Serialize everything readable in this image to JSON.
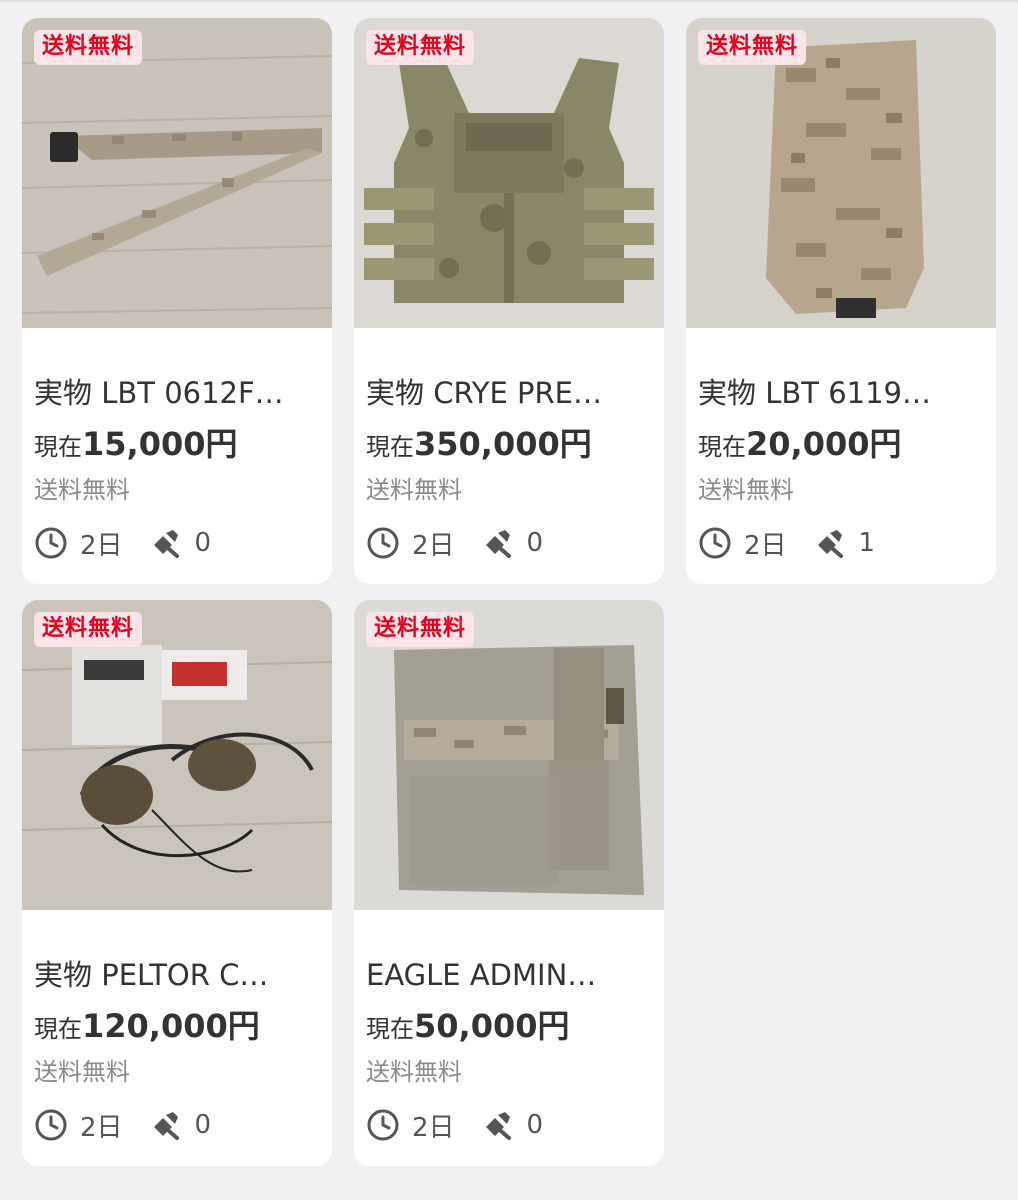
{
  "items": [
    {
      "badge": "送料無料",
      "title": "実物 LBT 0612F…",
      "price_label": "現在",
      "price": "15,000円",
      "shipping": "送料無料",
      "time_left": "2日",
      "bids": "0",
      "image": "camo-belt"
    },
    {
      "badge": "送料無料",
      "title": "実物 CRYE PRE…",
      "price_label": "現在",
      "price": "350,000円",
      "shipping": "送料無料",
      "time_left": "2日",
      "bids": "0",
      "image": "plate-carrier"
    },
    {
      "badge": "送料無料",
      "title": "実物 LBT 6119…",
      "price_label": "現在",
      "price": "20,000円",
      "shipping": "送料無料",
      "time_left": "2日",
      "bids": "1",
      "image": "hydration-carrier"
    },
    {
      "badge": "送料無料",
      "title": "実物 PELTOR C…",
      "price_label": "現在",
      "price": "120,000円",
      "shipping": "送料無料",
      "time_left": "2日",
      "bids": "0",
      "image": "headset"
    },
    {
      "badge": "送料無料",
      "title": "EAGLE ADMIN…",
      "price_label": "現在",
      "price": "50,000円",
      "shipping": "送料無料",
      "time_left": "2日",
      "bids": "0",
      "image": "admin-pouch"
    }
  ],
  "colors": {
    "badge_bg": "#fbe4e8",
    "badge_text": "#e5001f",
    "page_bg": "#f1f0f3"
  },
  "icons": {
    "time": "clock-icon",
    "bids": "gavel-icon"
  }
}
